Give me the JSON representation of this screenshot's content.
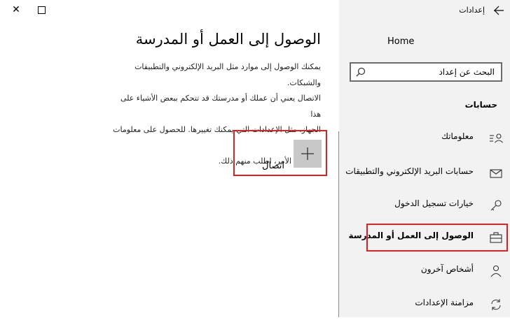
{
  "window": {
    "close_symbol": "✕",
    "maximize_symbol": "☐"
  },
  "main": {
    "title": "الوصول إلى العمل أو المدرسة",
    "description_lines": [
      "يمكنك الوصول إلى موارد مثل البريد الإلكتروني والتطبيقات والشبكات.",
      "الاتصال يعني أن عملك أو مدرستك قد تتحكم ببعض الأشياء على هذا",
      "الجهاز، مثل الإعدادات التي يمكنك تغييرها. للحصول على معلومات محددة",
      "حول هذا الأمر، اطلب منهم ذلك."
    ],
    "connect": {
      "label": "اتصال",
      "icon": "plus-icon"
    }
  },
  "sidebar": {
    "title": "إعدادات",
    "home": "Home",
    "search": {
      "placeholder": "البحث عن إعداد"
    },
    "section_header": "حسابات",
    "items": [
      {
        "label": "معلوماتك",
        "icon": "person-card-icon"
      },
      {
        "label": "حسابات البريد الإلكتروني والتطبيقات",
        "icon": "mail-icon"
      },
      {
        "label": "خيارات تسجيل الدخول",
        "icon": "key-icon"
      },
      {
        "label": "الوصول إلى العمل أو المدرسة",
        "icon": "briefcase-icon",
        "selected": true
      },
      {
        "label": "أشخاص آخرون",
        "icon": "person-add-icon"
      },
      {
        "label": "مزامنة الإعدادات",
        "icon": "sync-icon"
      }
    ]
  },
  "colors": {
    "highlight_border": "#e02020",
    "sidebar_bg": "#f2f2f2",
    "tile_bg": "#c8c8c8"
  }
}
